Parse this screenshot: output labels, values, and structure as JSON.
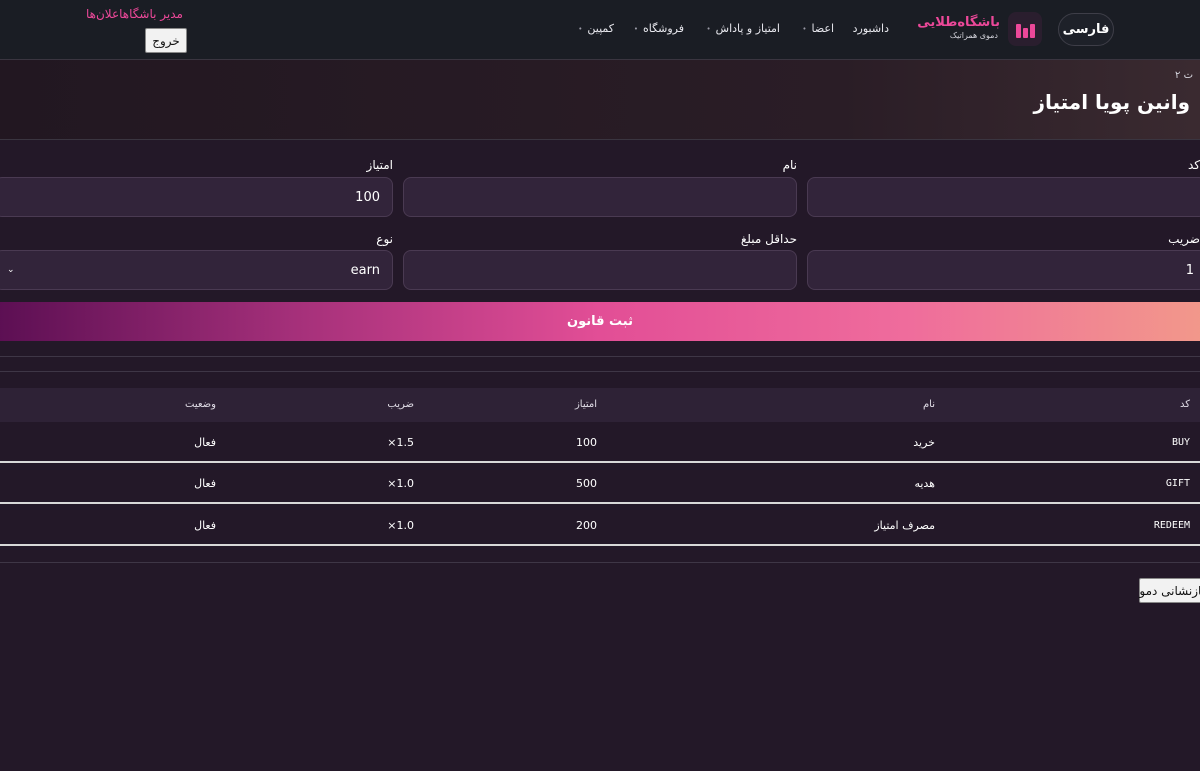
{
  "header": {
    "lang_button": "فارسی",
    "brand_title": "باشگاه‌طلایی",
    "brand_subtitle": "دموی همراتیک",
    "nav": [
      {
        "label": "داشبورد"
      },
      {
        "label": "اعضا"
      },
      {
        "label": "امتیاز و پاداش"
      },
      {
        "label": "فروشگاه"
      },
      {
        "label": "کمپین"
      }
    ],
    "announcements": "اعلان‌ها",
    "admin_label": "مدیر باشگاه",
    "logout": "خروج"
  },
  "hero": {
    "breadcrumb": "ت ۲",
    "title": "وانین پویا امتیاز"
  },
  "form": {
    "code_label": "کد",
    "code_value": "",
    "name_label": "نام",
    "name_value": "",
    "points_label": "امتیاز",
    "points_value": "100",
    "multiplier_label": "ضریب",
    "multiplier_value": "1",
    "min_amount_label": "حداقل مبلغ",
    "min_amount_value": "",
    "type_label": "نوع",
    "type_value": "earn",
    "submit": "ثبت قانون"
  },
  "table": {
    "headers": {
      "code": "کد",
      "name": "نام",
      "points": "امتیاز",
      "multiplier": "ضریب",
      "status": "وضعیت"
    },
    "rows": [
      {
        "code": "BUY",
        "name": "خرید",
        "points": "100",
        "multiplier": "1.5×",
        "status": "فعال"
      },
      {
        "code": "GIFT",
        "name": "هدیه",
        "points": "500",
        "multiplier": "1.0×",
        "status": "فعال"
      },
      {
        "code": "REDEEM",
        "name": "مصرف امتیاز",
        "points": "200",
        "multiplier": "1.0×",
        "status": "فعال"
      }
    ]
  },
  "footer": {
    "demo_reset": "بازنشانی دمو"
  },
  "colors": {
    "accent": "#ec4899",
    "background": "#231828",
    "header": "#1a1d24"
  }
}
